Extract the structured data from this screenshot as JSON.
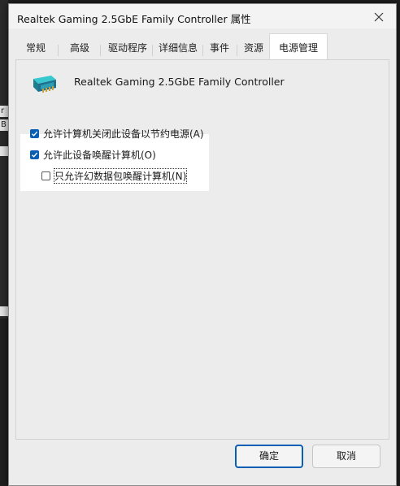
{
  "window": {
    "title": "Realtek Gaming 2.5GbE Family Controller 属性"
  },
  "background": {
    "fragment_a": "r",
    "fragment_b": "B"
  },
  "tabs": [
    {
      "label": "常规"
    },
    {
      "label": "高级"
    },
    {
      "label": "驱动程序"
    },
    {
      "label": "详细信息"
    },
    {
      "label": "事件"
    },
    {
      "label": "资源"
    },
    {
      "label": "电源管理",
      "active": true
    }
  ],
  "device": {
    "name": "Realtek Gaming 2.5GbE Family Controller",
    "icon": "network-adapter-icon"
  },
  "options": [
    {
      "label": "允许计算机关闭此设备以节约电源(A)",
      "checked": true
    },
    {
      "label": "允许此设备唤醒计算机(O)",
      "checked": true
    },
    {
      "label": "只允许幻数据包唤醒计算机(N)",
      "checked": false
    }
  ],
  "buttons": {
    "ok": "确定",
    "cancel": "取消"
  },
  "colors": {
    "accent": "#0a5fb4",
    "highlight": "#ffffff",
    "dialog_bg": "#ececec"
  }
}
